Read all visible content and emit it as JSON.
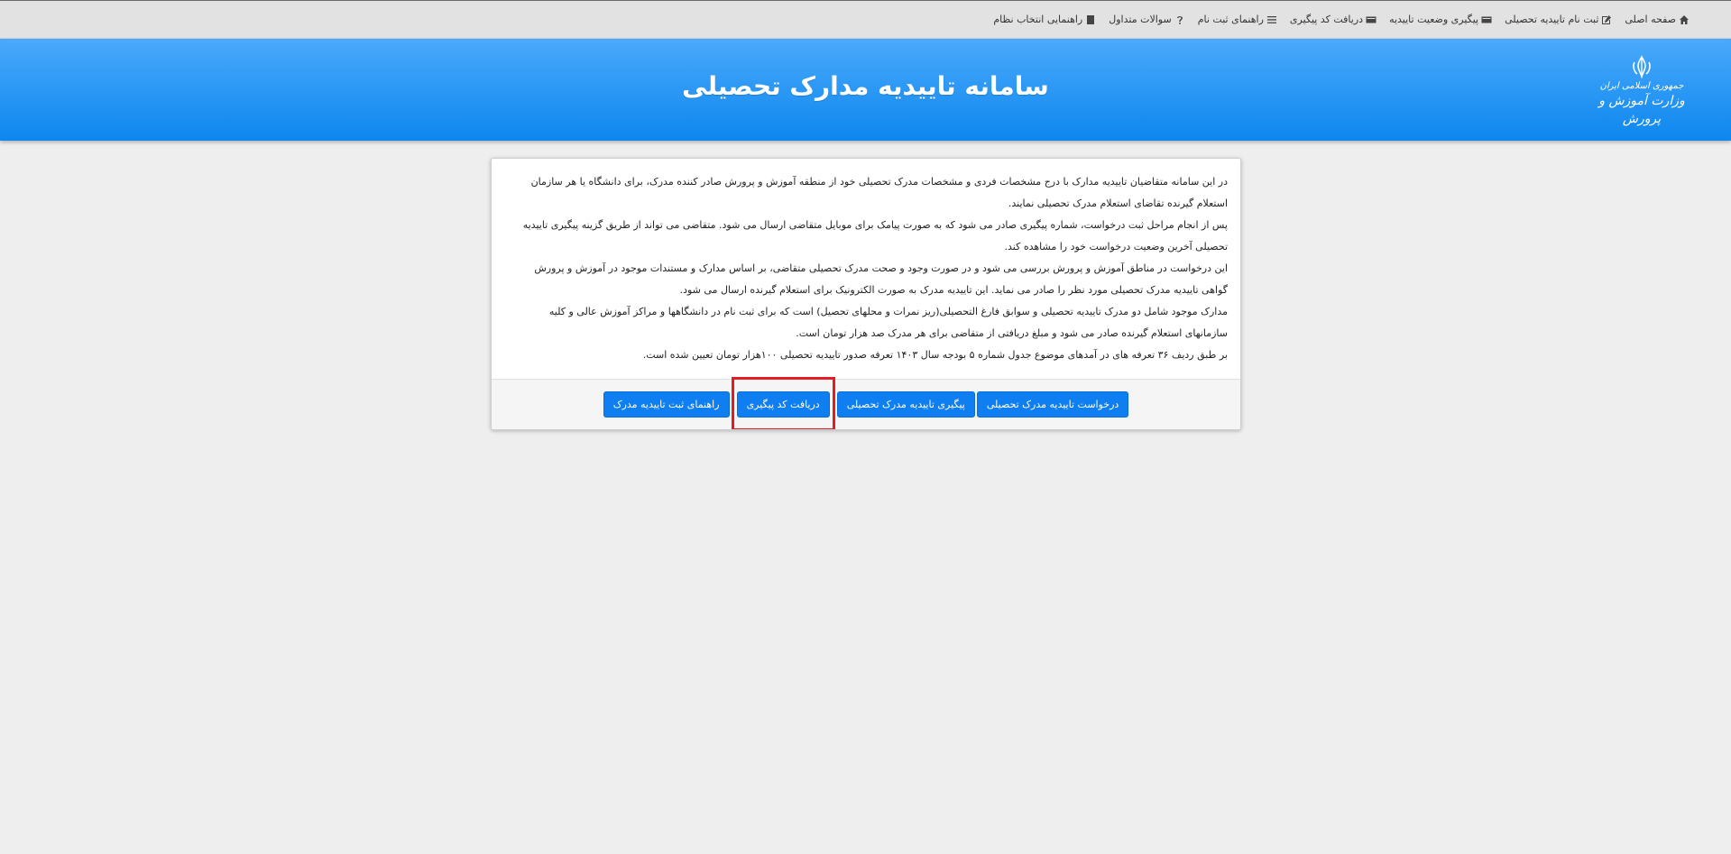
{
  "nav": {
    "items": [
      {
        "label": "صفحه اصلی",
        "icon": "home-icon"
      },
      {
        "label": "ثبت نام تاییدیه تحصیلی",
        "icon": "edit-icon"
      },
      {
        "label": "پیگیری وضعیت تاییدیه",
        "icon": "card-icon"
      },
      {
        "label": "دریافت کد پیگیری",
        "icon": "card-icon"
      },
      {
        "label": "راهنمای ثبت نام",
        "icon": "list-icon"
      },
      {
        "label": "سوالات متداول",
        "icon": "question-icon"
      },
      {
        "label": "راهنمایی انتخاب نظام",
        "icon": "book-icon"
      }
    ]
  },
  "header": {
    "title": "سامانه تاییدیه مدارک تحصیلی",
    "logo_line1": "جمهوری اسلامی ایران",
    "logo_line2": "وزارت آموزش و پرورش"
  },
  "card": {
    "paragraphs": [
      "در این سامانه متقاضیان تاییدیه مدارک با درج مشخصات فردی و مشخصات مدرک تحصیلی خود از منطقه آموزش و پرورش صادر کننده مدرک، برای دانشگاه یا هر سازمان استعلام گیرنده تقاضای استعلام مدرک تحصیلی نمایند.",
      "پس از انجام مراحل ثبت درخواست، شماره پیگیری صادر می شود که به صورت پیامک برای موبایل متقاضی ارسال می شود. متقاضی می تواند از طریق گزینه پیگیری تاییدیه تحصیلی آخرین وضعیت درخواست خود را مشاهده کند.",
      "این درخواست در مناطق آموزش و پرورش بررسی می شود و در صورت وجود و صحت مدرک تحصیلی متقاضی، بر اساس مدارک و مستندات موجود در آموزش و پرورش گواهی تاییدیه مدرک تحصیلی مورد نظر را صادر می نماید. این تاییدیه مدرک به صورت الکترونیک برای استعلام گیرنده ارسال می شود.",
      "مدارک موجود شامل دو مدرک تاییدیه تحصیلی و سوابق فارغ التحصیلی(ریز نمرات و محلهای تحصیل) است که برای ثبت نام در دانشگاهها و مراکز آموزش عالی و کلیه سازمانهای استعلام گیرنده صادر می شود و مبلغ دریافتی از متقاضی برای هر مدرک صد هزار تومان است.",
      "بر طبق ردیف ۳۶ تعرفه های در آمدهای موضوع جدول شماره ۵ بودجه سال ۱۴۰۳ تعرفه صدور تاییدیه تحصیلی ۱۰۰هزار تومان تعیین شده است."
    ],
    "buttons": {
      "request": "درخواست تاییدیه مدرک تحصیلی",
      "track": "پیگیری تاییدیه مدرک تحصیلی",
      "get_code": "دریافت کد پیگیری",
      "guide": "راهنمای ثبت تاییدیه مدرک"
    }
  },
  "colors": {
    "accent": "#0e7ef0",
    "highlight": "#e31b23",
    "header_top": "#4aa9fb",
    "header_bottom": "#0d87ee"
  }
}
